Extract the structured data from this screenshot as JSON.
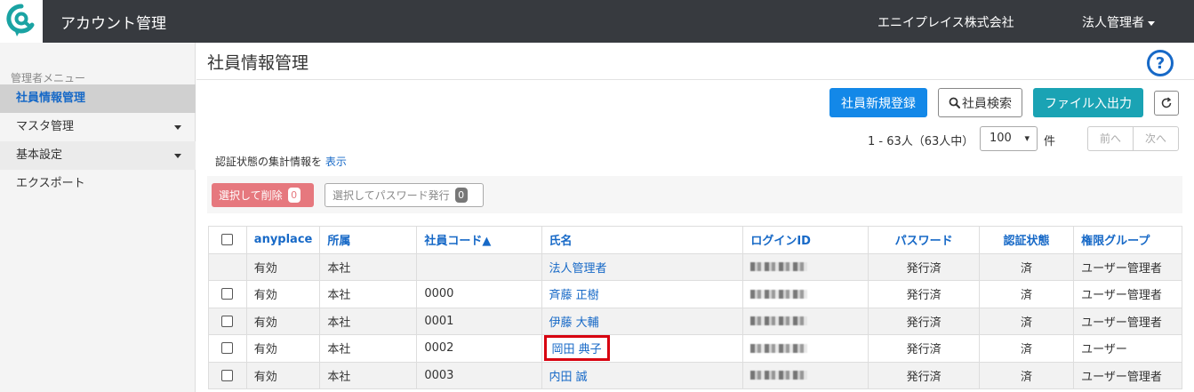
{
  "header": {
    "app_title": "アカウント管理",
    "company": "エニイプレイス株式会社",
    "user_menu": "法人管理者"
  },
  "sidebar": {
    "heading": "管理者メニュー",
    "items": [
      {
        "label": "社員情報管理"
      },
      {
        "label": "マスタ管理"
      },
      {
        "label": "基本設定"
      },
      {
        "label": "エクスポート"
      }
    ]
  },
  "main": {
    "title": "社員情報管理",
    "buttons": {
      "register": "社員新規登録",
      "search": "社員検索",
      "file_io": "ファイル入出力"
    },
    "pager": {
      "count_text": "1 - 63人（63人中）",
      "page_size": "100",
      "unit": "件",
      "prev": "前へ",
      "next": "次へ"
    },
    "auth_summary": {
      "text": "認証状態の集計情報を",
      "link": "表示"
    },
    "bulk": {
      "delete_label": "選択して削除",
      "delete_count": "0",
      "password_label": "選択してパスワード発行",
      "password_count": "0"
    },
    "table": {
      "headers": [
        "anyplace",
        "所属",
        "社員コード▲",
        "氏名",
        "ログインID",
        "パスワード",
        "認証状態",
        "権限グループ"
      ],
      "rows": [
        {
          "anyplace": "有効",
          "dept": "本社",
          "code": "",
          "name": "法人管理者",
          "password": "発行済",
          "auth": "済",
          "group": "ユーザー管理者"
        },
        {
          "anyplace": "有効",
          "dept": "本社",
          "code": "0000",
          "name": "斉藤 正樹",
          "password": "発行済",
          "auth": "済",
          "group": "ユーザー管理者"
        },
        {
          "anyplace": "有効",
          "dept": "本社",
          "code": "0001",
          "name": "伊藤 大輔",
          "password": "発行済",
          "auth": "済",
          "group": "ユーザー管理者"
        },
        {
          "anyplace": "有効",
          "dept": "本社",
          "code": "0002",
          "name": "岡田 典子",
          "password": "発行済",
          "auth": "済",
          "group": "ユーザー"
        },
        {
          "anyplace": "有効",
          "dept": "本社",
          "code": "0003",
          "name": "内田 誠",
          "password": "発行済",
          "auth": "済",
          "group": "ユーザー管理者"
        }
      ]
    }
  },
  "colors": {
    "topbar": "#373a3f",
    "primary": "#1388e8",
    "teal": "#1aa3b4",
    "danger": "#e6787e",
    "highlight": "#d7000f"
  }
}
